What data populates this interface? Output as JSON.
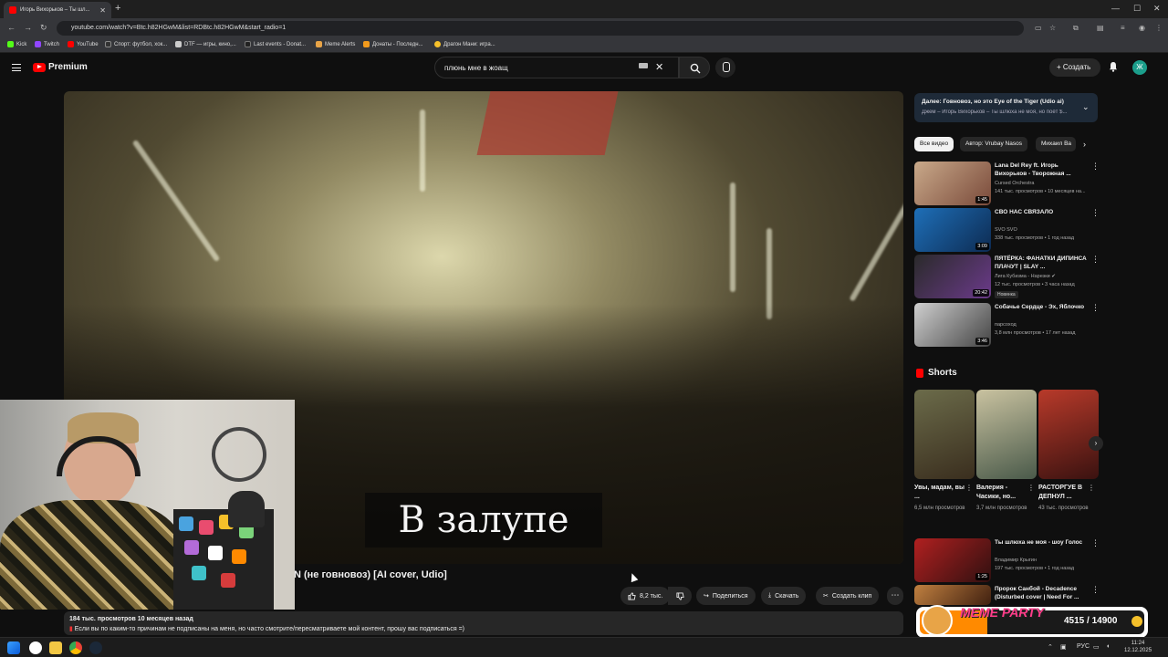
{
  "browser": {
    "tab_title": "Игорь Вихорьков – Ты шл...",
    "url": "youtube.com/watch?v=Btc.h82HGwM&list=RDBtc.h82HGwM&start_radio=1",
    "new_tab": "+",
    "bookmarks": [
      "Kick",
      "Twitch",
      "YouTube",
      "Спорт: футбол, хок...",
      "DTF — игры, кино,...",
      "Last events - Donat...",
      "Meme Alerts",
      "Донаты - Последн...",
      "Драгон Мани: игра..."
    ]
  },
  "header": {
    "logo_text": "Premium",
    "search_value": "плюнь мне в жоащ",
    "create_label": "Создать",
    "avatar_letter": "Ж"
  },
  "video": {
    "subtitle": "В залупе",
    "title": "N (не говновоз) [AI cover, Udio]",
    "likes": "8,2 тыс.",
    "share": "Поделиться",
    "download": "Скачать",
    "clip": "Создать клип",
    "views_date": "184 тыс. просмотров  10 месяцев назад",
    "description": "Если вы по каким-то причинам не подписаны на меня, но часто смотрите/пересматриваете мой контент, прошу вас подписаться =)"
  },
  "upnext": {
    "title": "Далее: Говновоз, но это Eye of the Tiger (Udio ai)",
    "subtitle": "Джем – Игорь Вихорьков – Ты шлюха не моя, но поёт $..."
  },
  "chips": [
    "Все видео",
    "Автор: Vrubay Nasos",
    "Михаил Ва"
  ],
  "related": [
    {
      "title": "Lana Del Rey ft. Игорь Вихорьков - Творожная ...",
      "channel": "Cursed Orchestra",
      "meta": "141 тыс. просмотров • 10 месяцев на...",
      "duration": "1:45",
      "badge": ""
    },
    {
      "title": "СВО НАС СВЯЗАЛО",
      "channel": "SVO SVO",
      "meta": "338 тыс. просмотров • 1 год назад",
      "duration": "3:09",
      "badge": ""
    },
    {
      "title": "ПЯТЁРКА: ФАНАТКИ ДИПИНСА ПЛАЧУТ | SLAY ...",
      "channel": "Лига Кубизма - Нарезки",
      "meta": "12 тыс. просмотров • 3 часа назад",
      "duration": "20:42",
      "badge": "Новинка"
    },
    {
      "title": "Собачье Сердце - Эх, Яблочко",
      "channel": "парсоход",
      "meta": "3,8 млн просмотров • 17 лет назад",
      "duration": "3:46",
      "badge": ""
    }
  ],
  "shorts": {
    "heading": "Shorts",
    "items": [
      {
        "title": "Увы, мадам, вы ...",
        "views": "6,5 млн просмотров"
      },
      {
        "title": "Валерия - Часики, но...",
        "views": "3,7 млн просмотров"
      },
      {
        "title": "РАСТОРГУЕ В ДЕПНУЛ ...",
        "views": "43 тыс. просмотров"
      }
    ]
  },
  "related2": [
    {
      "title": "Ты шлюха не моя - шоу Голос",
      "channel": "Владимир Крыгин",
      "meta": "197 тыс. просмотров • 1 год назад",
      "duration": "1:25"
    },
    {
      "title": "Пророк Санбой - Decadence (Disturbed cover | Need For ...",
      "channel": "",
      "meta": "",
      "duration": ""
    }
  ],
  "overlay": {
    "brand": "MEME PARTY",
    "progress": "4515 / 14900"
  },
  "taskbar": {
    "lang": "РУС",
    "time": "11:24",
    "date": "12.12.2025"
  },
  "colors": {
    "accent": "#ff0000",
    "bg": "#0f0f0f",
    "chip_active": "#f1f1f1",
    "upnext_bg": "#1e2a38"
  }
}
